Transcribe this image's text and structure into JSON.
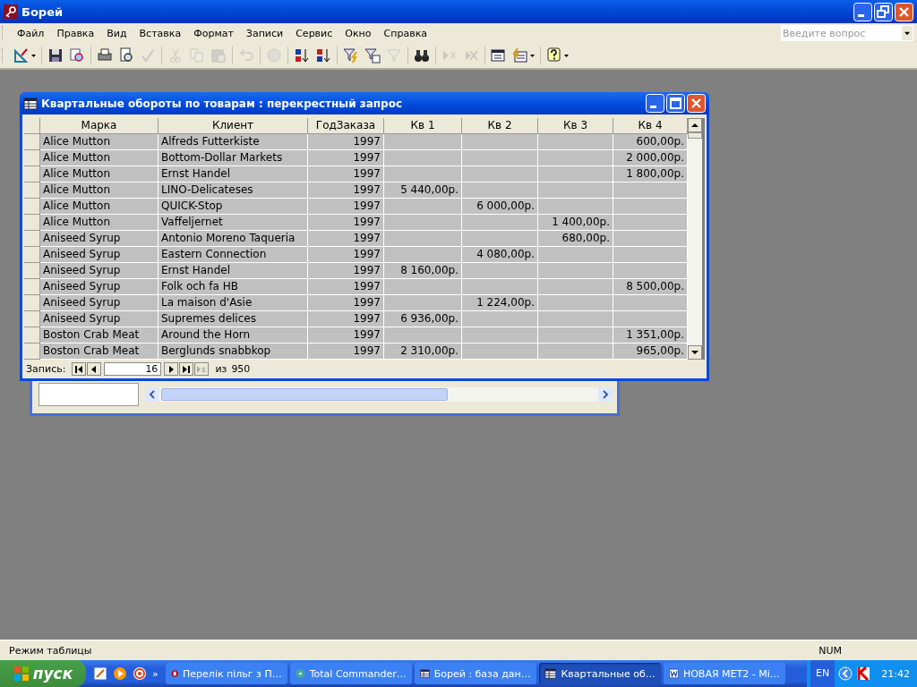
{
  "window": {
    "title": "Борей"
  },
  "menu": [
    "Файл",
    "Правка",
    "Вид",
    "Вставка",
    "Формат",
    "Записи",
    "Сервис",
    "Окно",
    "Справка"
  ],
  "help_box": {
    "placeholder": "Введите вопрос"
  },
  "toolbar": [
    {
      "kind": "design",
      "disabled": false
    },
    {
      "kind": "sep"
    },
    {
      "kind": "save",
      "disabled": false
    },
    {
      "kind": "search",
      "disabled": false
    },
    {
      "kind": "sep"
    },
    {
      "kind": "print",
      "disabled": false
    },
    {
      "kind": "preview",
      "disabled": false
    },
    {
      "kind": "spell",
      "disabled": true
    },
    {
      "kind": "sep"
    },
    {
      "kind": "cut",
      "disabled": true
    },
    {
      "kind": "copy",
      "disabled": true
    },
    {
      "kind": "paste",
      "disabled": true
    },
    {
      "kind": "sep"
    },
    {
      "kind": "undo",
      "disabled": true
    },
    {
      "kind": "sep"
    },
    {
      "kind": "globe",
      "disabled": true
    },
    {
      "kind": "sep"
    },
    {
      "kind": "sortasc",
      "disabled": false
    },
    {
      "kind": "sortdesc",
      "disabled": false
    },
    {
      "kind": "sep"
    },
    {
      "kind": "filter",
      "disabled": false
    },
    {
      "kind": "filterform",
      "disabled": false
    },
    {
      "kind": "funnel",
      "disabled": true
    },
    {
      "kind": "sep"
    },
    {
      "kind": "find",
      "disabled": false
    },
    {
      "kind": "sep"
    },
    {
      "kind": "newrec",
      "disabled": true
    },
    {
      "kind": "delrec",
      "disabled": true
    },
    {
      "kind": "sep"
    },
    {
      "kind": "dbwin",
      "disabled": false
    },
    {
      "kind": "newobj",
      "disabled": false
    },
    {
      "kind": "sep"
    },
    {
      "kind": "help",
      "disabled": false
    }
  ],
  "query_window": {
    "title": "Квартальные обороты по товарам : перекрестный запрос",
    "columns": [
      "Марка",
      "Клиент",
      "ГодЗаказа",
      "Кв 1",
      "Кв 2",
      "Кв 3",
      "Кв 4"
    ],
    "rows": [
      [
        "Alice Mutton",
        "Alfreds Futterkiste",
        "1997",
        "",
        "",
        "",
        "600,00р."
      ],
      [
        "Alice Mutton",
        "Bottom-Dollar Markets",
        "1997",
        "",
        "",
        "",
        "2 000,00р."
      ],
      [
        "Alice Mutton",
        "Ernst Handel",
        "1997",
        "",
        "",
        "",
        "1 800,00р."
      ],
      [
        "Alice Mutton",
        "LINO-Delicateses",
        "1997",
        "5 440,00р.",
        "",
        "",
        ""
      ],
      [
        "Alice Mutton",
        "QUICK-Stop",
        "1997",
        "",
        "6 000,00р.",
        "",
        ""
      ],
      [
        "Alice Mutton",
        "Vaffeljernet",
        "1997",
        "",
        "",
        "1 400,00р.",
        ""
      ],
      [
        "Aniseed Syrup",
        "Antonio Moreno Taqueria",
        "1997",
        "",
        "",
        "680,00р.",
        ""
      ],
      [
        "Aniseed Syrup",
        "Eastern Connection",
        "1997",
        "",
        "4 080,00р.",
        "",
        ""
      ],
      [
        "Aniseed Syrup",
        "Ernst Handel",
        "1997",
        "8 160,00р.",
        "",
        "",
        ""
      ],
      [
        "Aniseed Syrup",
        "Folk och fa HB",
        "1997",
        "",
        "",
        "",
        "8 500,00р."
      ],
      [
        "Aniseed Syrup",
        "La maison d'Asie",
        "1997",
        "",
        "1 224,00р.",
        "",
        ""
      ],
      [
        "Aniseed Syrup",
        "Supremes delices",
        "1997",
        "6 936,00р.",
        "",
        "",
        ""
      ],
      [
        "Boston Crab Meat",
        "Around the Horn",
        "1997",
        "",
        "",
        "",
        "1 351,00р."
      ],
      [
        "Boston Crab Meat",
        "Berglunds snabbkop",
        "1997",
        "2 310,00р.",
        "",
        "",
        "965,00р."
      ]
    ],
    "nav": {
      "label": "Запись:",
      "record": "16",
      "of": "из",
      "total": "950"
    }
  },
  "status_bar": {
    "mode": "Режим таблицы",
    "num": "NUM"
  },
  "taskbar": {
    "start": "пуск",
    "more": "»",
    "tasks": [
      {
        "label": "Перелік пільг з П…",
        "kind": "opera",
        "selected": false
      },
      {
        "label": "Total Commander…",
        "kind": "tc",
        "selected": false
      },
      {
        "label": "Борей : база дан…",
        "kind": "access",
        "selected": false
      },
      {
        "label": "Квартальные об…",
        "kind": "access",
        "selected": true
      },
      {
        "label": "НОВАЯ МЕТ2 - Mi…",
        "kind": "word",
        "selected": false
      }
    ],
    "lang": "EN",
    "time": "21:42"
  }
}
